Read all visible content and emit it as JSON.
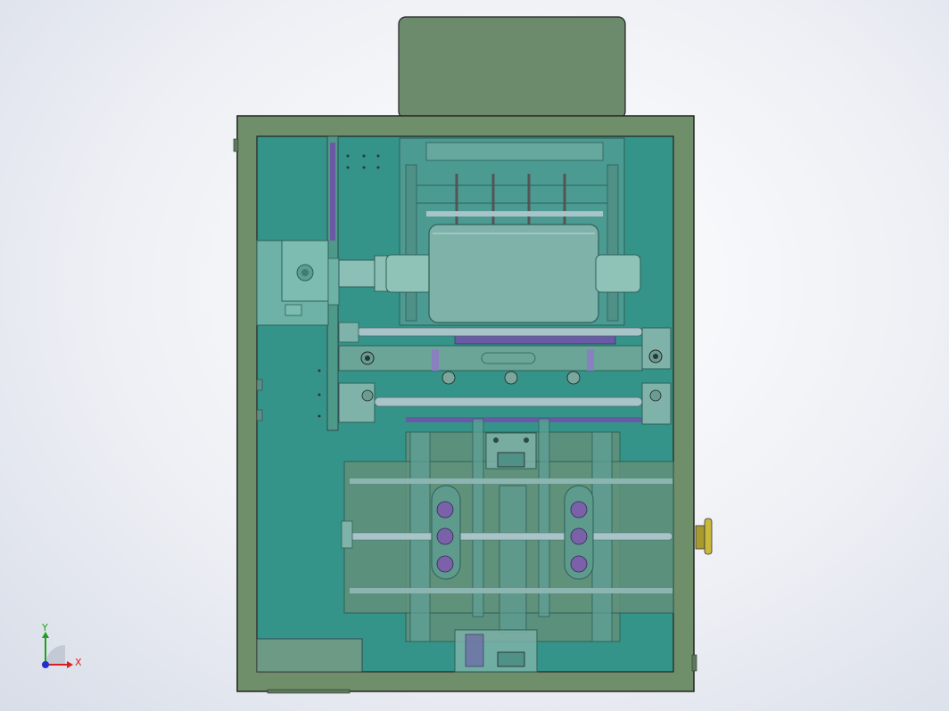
{
  "viewport": {
    "background_top": "#ffffff",
    "background_bottom": "#d8dde8"
  },
  "model": {
    "frame_color": "#6f8e6a",
    "panel_color": "#359489",
    "top_box_color": "#6c8a6c",
    "plate_color": "#62917a",
    "roller_color": "#7fb3aa",
    "rod_color": "#a9c4c9",
    "accent_purple": "#6a5aa6",
    "knob_color": "#c9b83a"
  },
  "triad": {
    "x_label": "X",
    "y_label": "Y",
    "x_color": "#d62020",
    "y_color": "#20a020",
    "z_color": "#2030d0"
  }
}
